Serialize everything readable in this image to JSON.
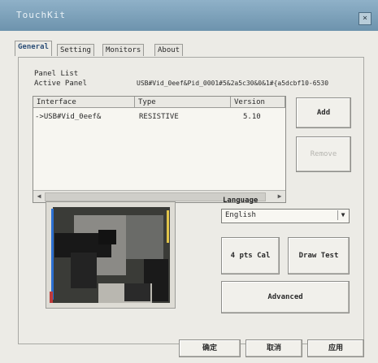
{
  "window": {
    "title": "TouchKit",
    "close_icon": "×"
  },
  "tabs": [
    "General",
    "Setting",
    "Monitors",
    "About"
  ],
  "general": {
    "panel_list_label": "Panel List",
    "active_panel_label": "Active Panel",
    "active_panel_value": "USB#Vid_0eef&Pid_0001#5&2a5c30&0&1#{a5dcbf10-6530",
    "columns": [
      "Interface",
      "Type",
      "Version"
    ],
    "rows": [
      {
        "interface": "->USB#Vid_0eef&",
        "type": "RESISTIVE",
        "version": "5.10"
      }
    ],
    "add_label": "Add",
    "remove_label": "Remove",
    "language_label": "Language",
    "language_value": "English",
    "four_pts_cal_label": "4 pts Cal",
    "draw_test_label": "Draw Test",
    "advanced_label": "Advanced"
  },
  "footer": {
    "ok_label": "确定",
    "cancel_label": "取消",
    "apply_label": "应用"
  },
  "colors": {
    "titlebar": "#7ea3bd",
    "accent_tab": "#2d4f78"
  }
}
